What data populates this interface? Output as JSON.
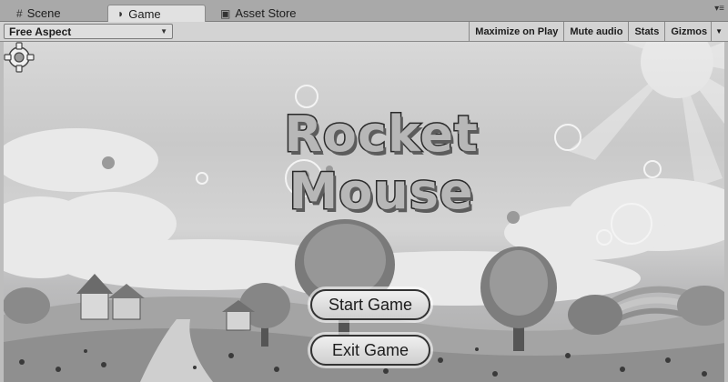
{
  "tabs": [
    {
      "label": "Scene",
      "icon": "grid-icon",
      "active": false
    },
    {
      "label": "Game",
      "icon": "game-controller-icon",
      "active": true
    },
    {
      "label": "Asset Store",
      "icon": "store-bag-icon",
      "active": false
    }
  ],
  "window_controls": "▾≡",
  "toolbar": {
    "aspect": "Free Aspect",
    "maximize_on_play": "Maximize on Play",
    "mute_audio": "Mute audio",
    "stats": "Stats",
    "gizmos": "Gizmos"
  },
  "game": {
    "title": "Rocket Mouse",
    "start_button": "Start Game",
    "exit_button": "Exit Game",
    "settings_icon": "gear-icon"
  },
  "colors": {
    "tabbar": "#a9a9a9",
    "toolbar": "#d3d3d3",
    "active_tab": "#e1e1e1"
  }
}
